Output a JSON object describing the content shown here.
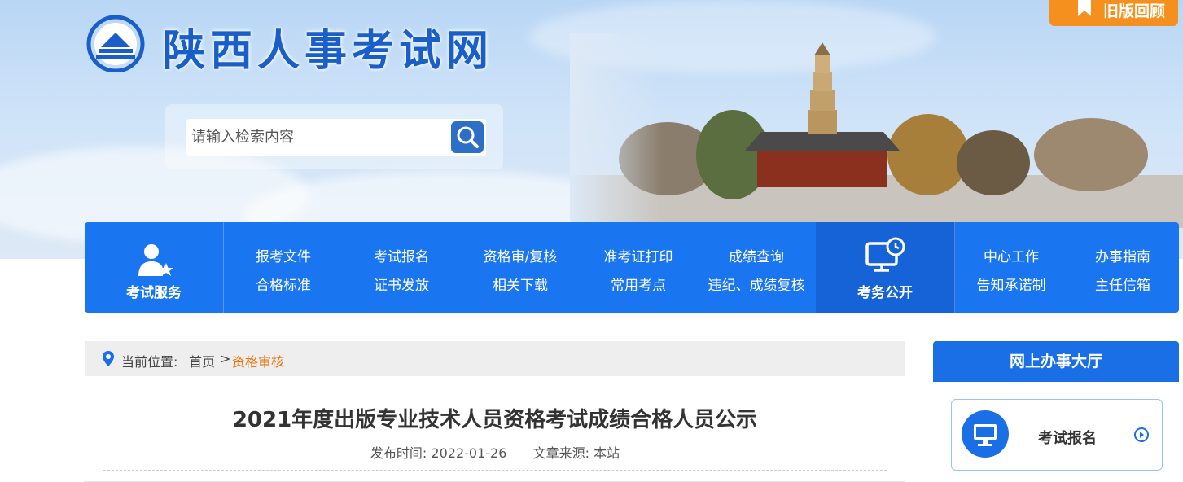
{
  "header": {
    "site_title": "陕西人事考试网",
    "old_version": "旧版回顾",
    "search_placeholder": "请输入检索内容"
  },
  "nav": {
    "service_title": "考试服务",
    "service_links": [
      {
        "label": "报考文件"
      },
      {
        "label": "考试报名"
      },
      {
        "label": "资格审/复核"
      },
      {
        "label": "准考证打印"
      },
      {
        "label": "成绩查询"
      },
      {
        "label": "合格标准"
      },
      {
        "label": "证书发放"
      },
      {
        "label": "相关下载"
      },
      {
        "label": "常用考点"
      },
      {
        "label": "违纪、成绩复核"
      }
    ],
    "affairs_title": "考务公开",
    "affairs_links": [
      {
        "label": "中心工作"
      },
      {
        "label": "办事指南"
      },
      {
        "label": "告知承诺制"
      },
      {
        "label": "主任信箱"
      }
    ]
  },
  "breadcrumb": {
    "prefix": "当前位置:",
    "home": "首页",
    "sep": ">",
    "current": "资格审核"
  },
  "article": {
    "title": "2021年度出版专业技术人员资格考试成绩合格人员公示",
    "publish_label": "发布时间:",
    "publish_date": "2022-01-26",
    "source_label": "文章来源:",
    "source": "本站"
  },
  "sidebar": {
    "hall_title": "网上办事大厅",
    "card_label": "考试报名"
  },
  "colors": {
    "nav_blue": "#1a76f0",
    "accent_orange": "#f5901e",
    "breadcrumb_current": "#e8760c"
  }
}
